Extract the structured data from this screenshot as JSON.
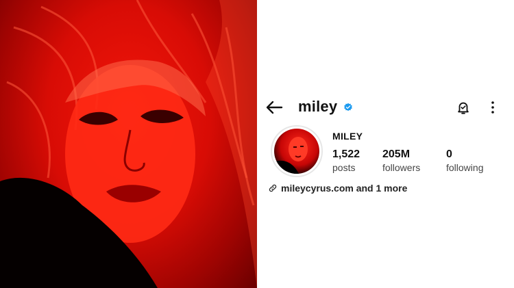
{
  "colors": {
    "accent_red": "#d80c05",
    "verified_blue": "#1d9bf0",
    "text_primary": "#111111",
    "text_secondary": "#444444"
  },
  "header": {
    "back_icon": "back-arrow-icon",
    "username": "miley",
    "verified_icon": "verified-badge-icon",
    "notifications_icon": "bell-icon",
    "more_icon": "more-vertical-icon"
  },
  "profile": {
    "display_name": "MILEY",
    "stats": [
      {
        "value": "1,522",
        "label": "posts"
      },
      {
        "value": "205M",
        "label": "followers"
      },
      {
        "value": "0",
        "label": "following"
      }
    ],
    "link_icon": "link-icon",
    "link_text": "mileycyrus.com and 1 more"
  }
}
